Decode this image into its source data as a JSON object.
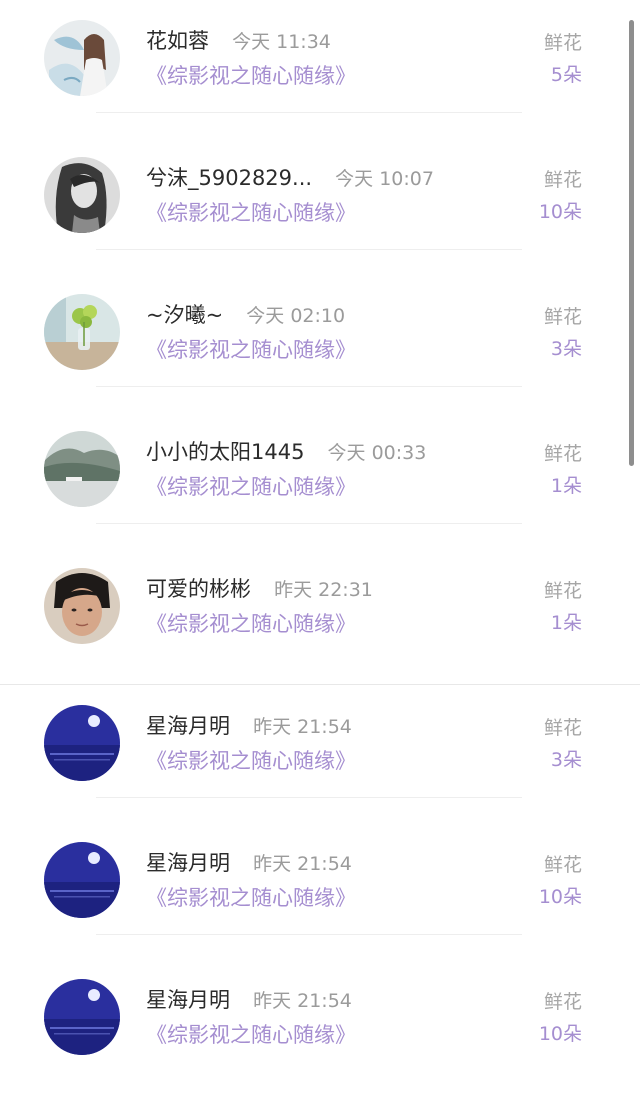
{
  "records": [
    {
      "name": "花如蓉",
      "time": "今天 11:34",
      "book": "《综影视之随心随缘》",
      "gift_label": "鲜花",
      "gift_count": "5朵",
      "avatar": "girl-illustration-avatar"
    },
    {
      "name": "兮沫_5902829...",
      "time": "今天 10:07",
      "book": "《综影视之随心随缘》",
      "gift_label": "鲜花",
      "gift_count": "10朵",
      "avatar": "bw-portrait-avatar"
    },
    {
      "name": "~汐曦~",
      "time": "今天 02:10",
      "book": "《综影视之随心随缘》",
      "gift_label": "鲜花",
      "gift_count": "3朵",
      "avatar": "flower-vase-avatar"
    },
    {
      "name": "小小的太阳1445",
      "time": "今天 00:33",
      "book": "《综影视之随心随缘》",
      "gift_label": "鲜花",
      "gift_count": "1朵",
      "avatar": "landscape-avatar"
    },
    {
      "name": "可爱的彬彬",
      "time": "昨天 22:31",
      "book": "《综影视之随心随缘》",
      "gift_label": "鲜花",
      "gift_count": "1朵",
      "avatar": "face-avatar"
    },
    {
      "name": "星海月明",
      "time": "昨天 21:54",
      "book": "《综影视之随心随缘》",
      "gift_label": "鲜花",
      "gift_count": "3朵",
      "avatar": "moon-night-avatar"
    },
    {
      "name": "星海月明",
      "time": "昨天 21:54",
      "book": "《综影视之随心随缘》",
      "gift_label": "鲜花",
      "gift_count": "10朵",
      "avatar": "moon-night-avatar"
    },
    {
      "name": "星海月明",
      "time": "昨天 21:54",
      "book": "《综影视之随心随缘》",
      "gift_label": "鲜花",
      "gift_count": "10朵",
      "avatar": "moon-night-avatar"
    }
  ],
  "colors": {
    "accent": "#a58ed0",
    "name": "#2b2b2b",
    "muted": "#9b9b9b",
    "divider": "#eeeeee"
  }
}
